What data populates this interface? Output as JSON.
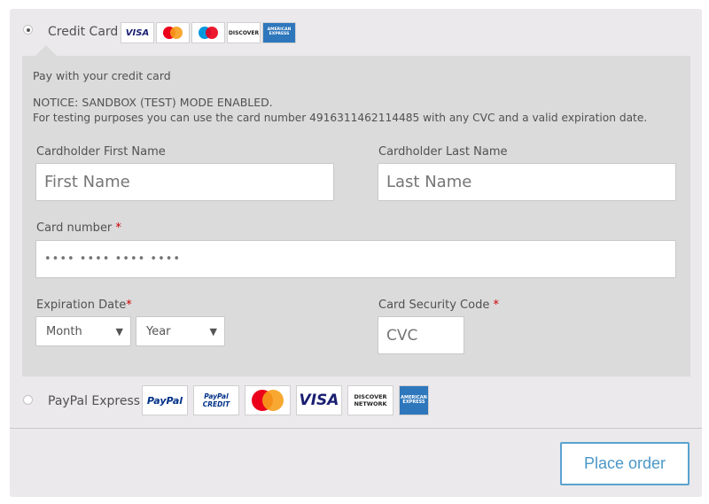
{
  "credit_card": {
    "label": "Credit Card",
    "logos": [
      "VISA",
      "MasterCard",
      "Maestro",
      "DISCOVER",
      "AMERICAN EXPRESS"
    ],
    "description": "Pay with your credit card",
    "notice_line1": "NOTICE: SANDBOX (TEST) MODE ENABLED.",
    "notice_line2": "For testing purposes you can use the card number 4916311462114485 with any CVC and a valid expiration date.",
    "first_name_label": "Cardholder First Name",
    "first_name_placeholder": "First Name",
    "last_name_label": "Cardholder Last Name",
    "last_name_placeholder": "Last Name",
    "card_number_label": "Card number",
    "card_number_placeholder": "•••• •••• •••• ••••",
    "expiration_label": "Expiration Date",
    "month_value": "Month",
    "year_value": "Year",
    "security_label": "Card Security Code",
    "cvc_placeholder": "CVC",
    "required_mark": "*"
  },
  "paypal": {
    "label": "PayPal Express",
    "logos": [
      "PayPal",
      "PayPal CREDIT",
      "MasterCard",
      "VISA",
      "DISCOVER NETWORK",
      "AMERICAN EXPRESS"
    ]
  },
  "place_order_label": "Place order",
  "colors": {
    "panel": "#ebe9eb",
    "cc_box": "#dcdbdc",
    "button_border": "#5aa3cf",
    "required": "#cc0000",
    "visa_blue": "#1a1f71",
    "mastercard_red": "#eb001b",
    "mastercard_orange": "#f79e1b",
    "amex_blue": "#2e77bc",
    "paypal_blue": "#003087"
  }
}
